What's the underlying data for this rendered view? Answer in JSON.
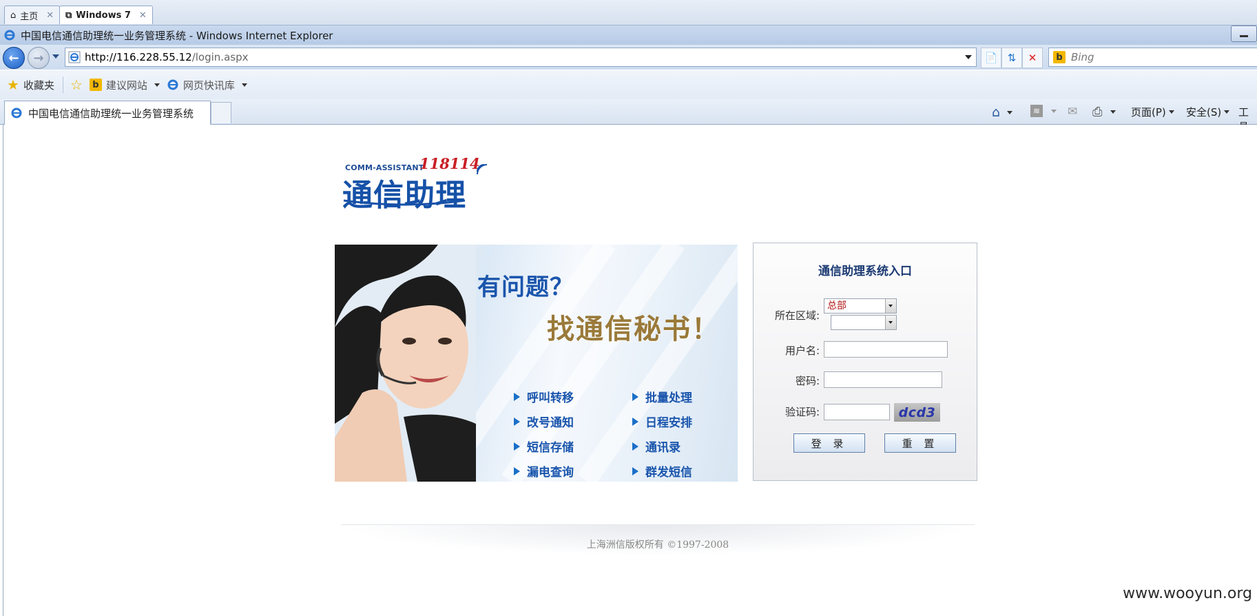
{
  "host_tabs": [
    {
      "label": "主页",
      "icon": "home-icon",
      "active": false
    },
    {
      "label": "Windows 7",
      "icon": "vm-icon",
      "active": true
    }
  ],
  "window": {
    "title": "中国电信通信助理统一业务管理系统 - Windows Internet Explorer"
  },
  "address": {
    "host": "http://116.228.55.12",
    "rest": "/login.aspx"
  },
  "search": {
    "placeholder": "Bing"
  },
  "favorites": {
    "label": "收藏夹",
    "items": [
      {
        "label": "建议网站"
      },
      {
        "label": "网页快讯库"
      }
    ]
  },
  "tab": {
    "title": "中国电信通信助理统一业务管理系统"
  },
  "commands": {
    "page": "页面(P)",
    "safety": "安全(S)",
    "tools": "工具"
  },
  "logo": {
    "en": "COMM-ASSISTANT",
    "num": "118114",
    "cn": "通信助理"
  },
  "banner": {
    "question": "有问题？",
    "answer": "找通信秘书！",
    "features_left": [
      "呼叫转移",
      "改号通知",
      "短信存储",
      "漏电查询"
    ],
    "features_right": [
      "批量处理",
      "日程安排",
      "通讯录",
      "群发短信"
    ]
  },
  "login": {
    "title": "通信助理系统入口",
    "region_label": "所在区域:",
    "region_value": "总部",
    "region_sub_value": "",
    "username_label": "用户名:",
    "username_value": "",
    "password_label": "密码:",
    "password_value": "",
    "captcha_label": "验证码:",
    "captcha_value": "",
    "captcha_image_text": "dcd3",
    "login_button": "登 录",
    "reset_button": "重 置"
  },
  "footer": {
    "text": "上海洲信版权所有 ©1997-2008"
  },
  "watermark": "www.wooyun.org",
  "colors": {
    "brand_blue": "#1651a8",
    "brand_red": "#c81f25",
    "feature_blue": "#1a55ac"
  }
}
